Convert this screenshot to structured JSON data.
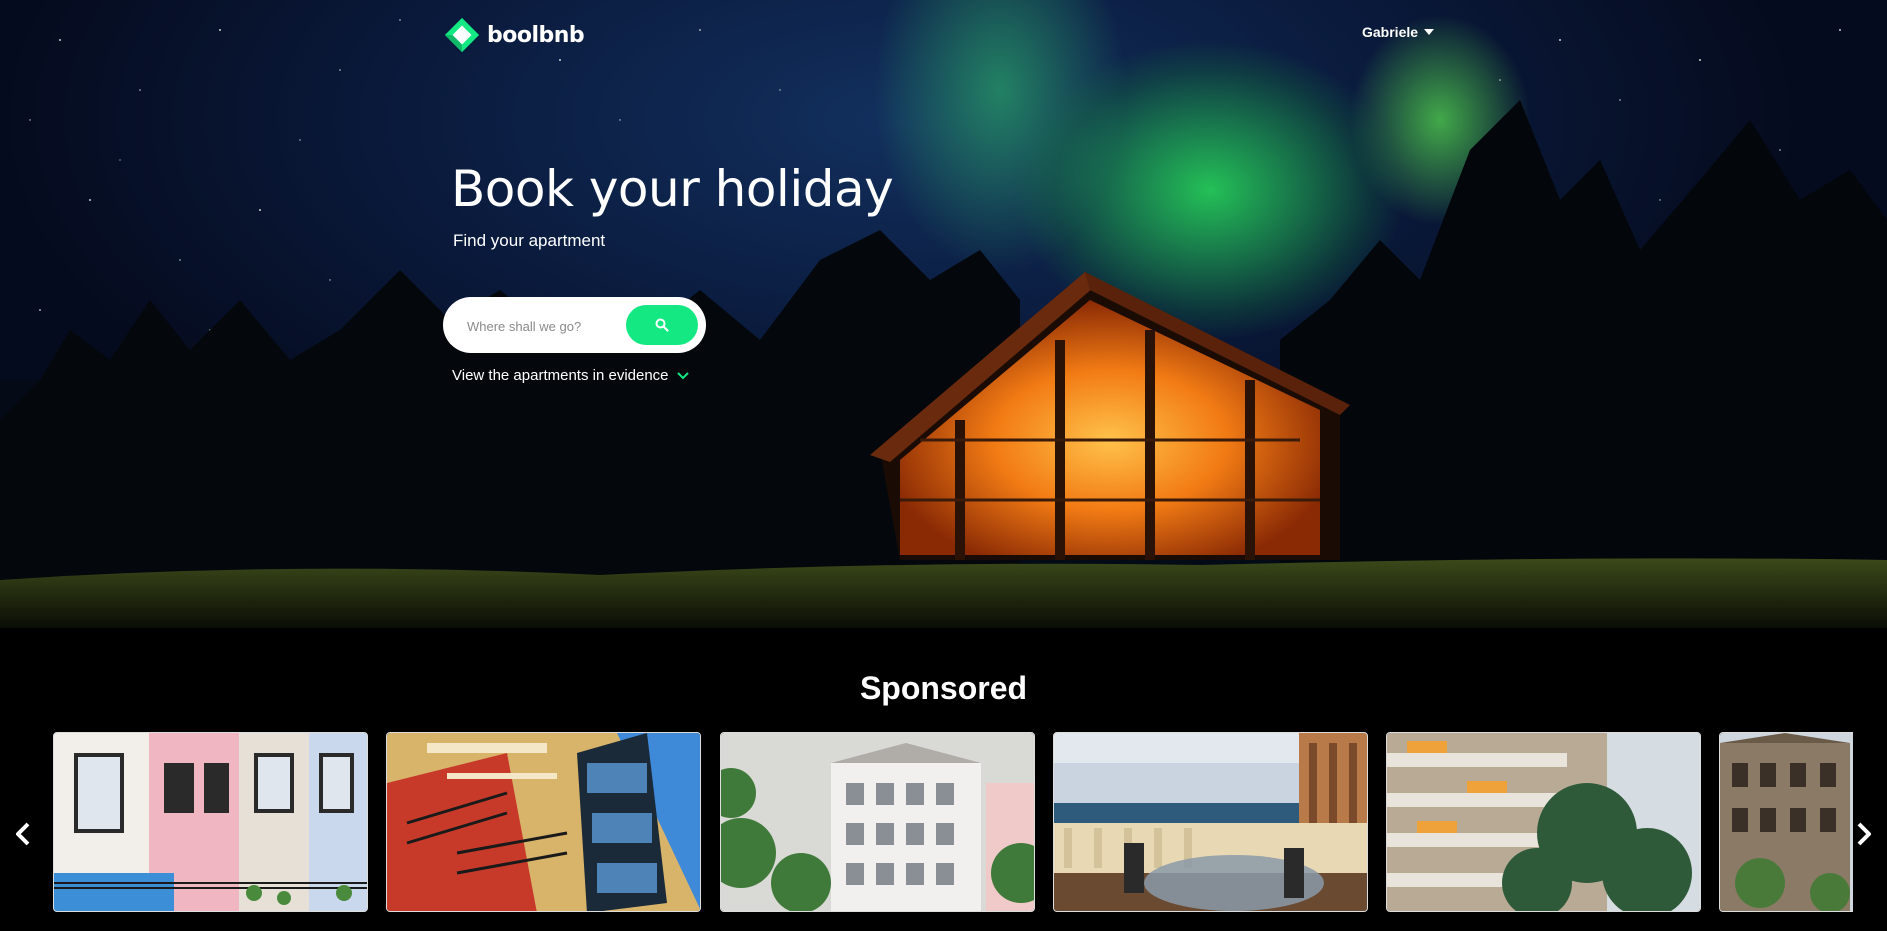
{
  "brand": {
    "name": "boolbnb",
    "accent": "#14e882"
  },
  "nav": {
    "user_name": "Gabriele"
  },
  "hero": {
    "title": "Book your holiday",
    "subtitle": "Find your apartment",
    "search_placeholder": "Where shall we go?",
    "evidence_link": "View the apartments in evidence"
  },
  "sponsored": {
    "title": "Sponsored",
    "cards": [
      {
        "name": "apartment-photo-1"
      },
      {
        "name": "apartment-photo-2"
      },
      {
        "name": "apartment-photo-3"
      },
      {
        "name": "apartment-photo-4"
      },
      {
        "name": "apartment-photo-5"
      },
      {
        "name": "apartment-photo-6"
      }
    ]
  },
  "icons": {
    "search": "search-icon",
    "chevron": "chevron-down-icon",
    "prev": "chevron-left-icon",
    "next": "chevron-right-icon"
  }
}
